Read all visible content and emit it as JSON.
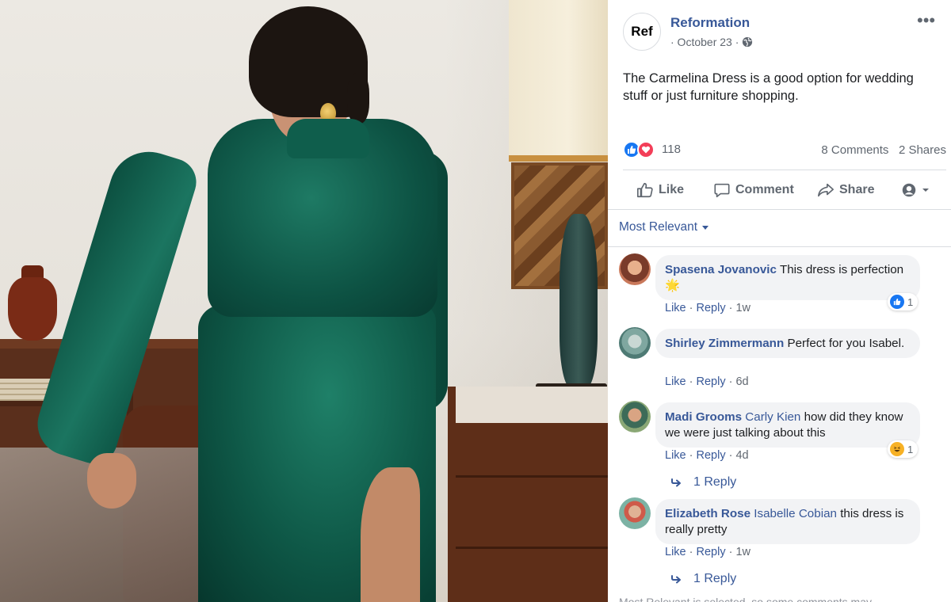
{
  "post": {
    "page_name": "Reformation",
    "avatar_text": "Ref",
    "date": "· October 23 ·",
    "text": "The Carmelina Dress is a good option for wedding stuff or just furniture shopping.",
    "reactions_count": "118",
    "comments_count": "8 Comments",
    "shares_count": "2 Shares"
  },
  "actions": {
    "like_label": "Like",
    "comment_label": "Comment",
    "share_label": "Share"
  },
  "sort": {
    "label": "Most Relevant"
  },
  "comments": [
    {
      "author": "Spasena Jovanovic",
      "mention": "",
      "text": "This dress is perfection 🌟",
      "like_label": "Like",
      "reply_label": "Reply",
      "time": "1w",
      "reaction_count": "1",
      "reaction_icon": "like-icon"
    },
    {
      "author": "Shirley Zimmermann",
      "mention": "",
      "text": "Perfect for you Isabel.",
      "like_label": "Like",
      "reply_label": "Reply",
      "time": "6d"
    },
    {
      "author": "Madi Grooms",
      "mention": "Carly Kien",
      "text": "how did they know we were just talking about this",
      "like_label": "Like",
      "reply_label": "Reply",
      "time": "4d",
      "reaction_count": "1",
      "reaction_icon": "haha-icon",
      "replies_label": "1 Reply"
    },
    {
      "author": "Elizabeth Rose",
      "mention": "Isabelle Cobian",
      "text": "this dress is really pretty",
      "like_label": "Like",
      "reply_label": "Reply",
      "time": "1w",
      "replies_label": "1 Reply"
    }
  ],
  "footer": {
    "cutoff_text": "Most Relevant is selected, so some comments may"
  },
  "colors": {
    "link_blue": "#385898",
    "like_blue": "#1877f2",
    "love_red": "#f33e58",
    "bubble_gray": "#f2f3f5",
    "meta_gray": "#606770"
  }
}
